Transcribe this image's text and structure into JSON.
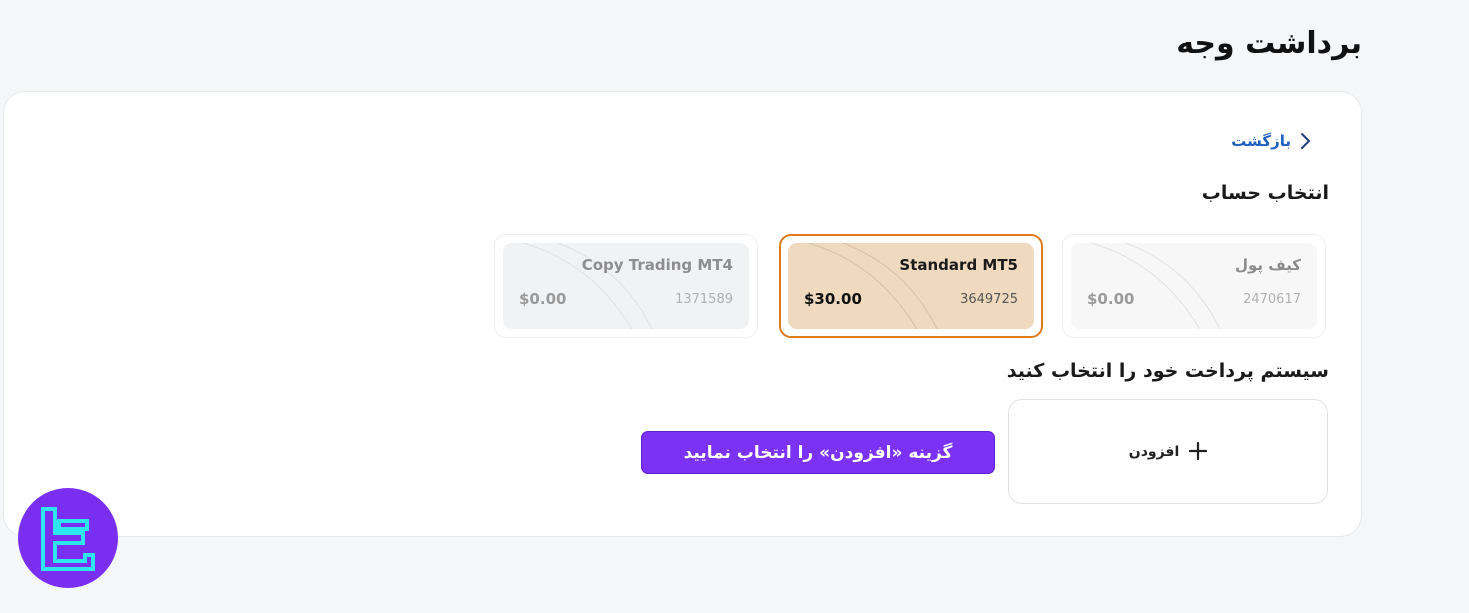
{
  "page": {
    "title": "برداشت وجه"
  },
  "nav": {
    "back_label": "بازگشت"
  },
  "accounts_section": {
    "title": "انتخاب حساب",
    "accounts": [
      {
        "name": "کیف پول",
        "number": "2470617",
        "balance": "$0.00",
        "selected": false
      },
      {
        "name": "Standard MT5",
        "number": "3649725",
        "balance": "$30.00",
        "selected": true
      },
      {
        "name": "Copy Trading MT4",
        "number": "1371589",
        "balance": "$0.00",
        "selected": false
      }
    ]
  },
  "payment_section": {
    "title": "سیستم پرداخت خود را انتخاب کنید",
    "add_label": "افزودن",
    "cta_label": "گزینه «افزودن» را انتخاب نمایید"
  },
  "colors": {
    "accent_purple": "#7b32f5",
    "selected_border": "#e07a1f",
    "selected_card": "#efd9bf",
    "link_blue": "#1f5fbf"
  },
  "icons": {
    "back": "chevron-right-icon",
    "add": "plus-icon",
    "logo": "brand-logo-icon"
  }
}
